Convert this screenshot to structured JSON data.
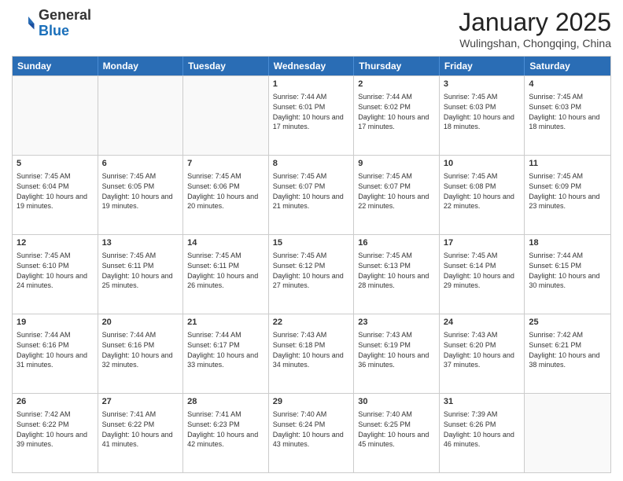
{
  "header": {
    "logo_general": "General",
    "logo_blue": "Blue",
    "month_title": "January 2025",
    "location": "Wulingshan, Chongqing, China"
  },
  "days_of_week": [
    "Sunday",
    "Monday",
    "Tuesday",
    "Wednesday",
    "Thursday",
    "Friday",
    "Saturday"
  ],
  "weeks": [
    [
      {
        "day": "",
        "sunrise": "",
        "sunset": "",
        "daylight": ""
      },
      {
        "day": "",
        "sunrise": "",
        "sunset": "",
        "daylight": ""
      },
      {
        "day": "",
        "sunrise": "",
        "sunset": "",
        "daylight": ""
      },
      {
        "day": "1",
        "sunrise": "Sunrise: 7:44 AM",
        "sunset": "Sunset: 6:01 PM",
        "daylight": "Daylight: 10 hours and 17 minutes."
      },
      {
        "day": "2",
        "sunrise": "Sunrise: 7:44 AM",
        "sunset": "Sunset: 6:02 PM",
        "daylight": "Daylight: 10 hours and 17 minutes."
      },
      {
        "day": "3",
        "sunrise": "Sunrise: 7:45 AM",
        "sunset": "Sunset: 6:03 PM",
        "daylight": "Daylight: 10 hours and 18 minutes."
      },
      {
        "day": "4",
        "sunrise": "Sunrise: 7:45 AM",
        "sunset": "Sunset: 6:03 PM",
        "daylight": "Daylight: 10 hours and 18 minutes."
      }
    ],
    [
      {
        "day": "5",
        "sunrise": "Sunrise: 7:45 AM",
        "sunset": "Sunset: 6:04 PM",
        "daylight": "Daylight: 10 hours and 19 minutes."
      },
      {
        "day": "6",
        "sunrise": "Sunrise: 7:45 AM",
        "sunset": "Sunset: 6:05 PM",
        "daylight": "Daylight: 10 hours and 19 minutes."
      },
      {
        "day": "7",
        "sunrise": "Sunrise: 7:45 AM",
        "sunset": "Sunset: 6:06 PM",
        "daylight": "Daylight: 10 hours and 20 minutes."
      },
      {
        "day": "8",
        "sunrise": "Sunrise: 7:45 AM",
        "sunset": "Sunset: 6:07 PM",
        "daylight": "Daylight: 10 hours and 21 minutes."
      },
      {
        "day": "9",
        "sunrise": "Sunrise: 7:45 AM",
        "sunset": "Sunset: 6:07 PM",
        "daylight": "Daylight: 10 hours and 22 minutes."
      },
      {
        "day": "10",
        "sunrise": "Sunrise: 7:45 AM",
        "sunset": "Sunset: 6:08 PM",
        "daylight": "Daylight: 10 hours and 22 minutes."
      },
      {
        "day": "11",
        "sunrise": "Sunrise: 7:45 AM",
        "sunset": "Sunset: 6:09 PM",
        "daylight": "Daylight: 10 hours and 23 minutes."
      }
    ],
    [
      {
        "day": "12",
        "sunrise": "Sunrise: 7:45 AM",
        "sunset": "Sunset: 6:10 PM",
        "daylight": "Daylight: 10 hours and 24 minutes."
      },
      {
        "day": "13",
        "sunrise": "Sunrise: 7:45 AM",
        "sunset": "Sunset: 6:11 PM",
        "daylight": "Daylight: 10 hours and 25 minutes."
      },
      {
        "day": "14",
        "sunrise": "Sunrise: 7:45 AM",
        "sunset": "Sunset: 6:11 PM",
        "daylight": "Daylight: 10 hours and 26 minutes."
      },
      {
        "day": "15",
        "sunrise": "Sunrise: 7:45 AM",
        "sunset": "Sunset: 6:12 PM",
        "daylight": "Daylight: 10 hours and 27 minutes."
      },
      {
        "day": "16",
        "sunrise": "Sunrise: 7:45 AM",
        "sunset": "Sunset: 6:13 PM",
        "daylight": "Daylight: 10 hours and 28 minutes."
      },
      {
        "day": "17",
        "sunrise": "Sunrise: 7:45 AM",
        "sunset": "Sunset: 6:14 PM",
        "daylight": "Daylight: 10 hours and 29 minutes."
      },
      {
        "day": "18",
        "sunrise": "Sunrise: 7:44 AM",
        "sunset": "Sunset: 6:15 PM",
        "daylight": "Daylight: 10 hours and 30 minutes."
      }
    ],
    [
      {
        "day": "19",
        "sunrise": "Sunrise: 7:44 AM",
        "sunset": "Sunset: 6:16 PM",
        "daylight": "Daylight: 10 hours and 31 minutes."
      },
      {
        "day": "20",
        "sunrise": "Sunrise: 7:44 AM",
        "sunset": "Sunset: 6:16 PM",
        "daylight": "Daylight: 10 hours and 32 minutes."
      },
      {
        "day": "21",
        "sunrise": "Sunrise: 7:44 AM",
        "sunset": "Sunset: 6:17 PM",
        "daylight": "Daylight: 10 hours and 33 minutes."
      },
      {
        "day": "22",
        "sunrise": "Sunrise: 7:43 AM",
        "sunset": "Sunset: 6:18 PM",
        "daylight": "Daylight: 10 hours and 34 minutes."
      },
      {
        "day": "23",
        "sunrise": "Sunrise: 7:43 AM",
        "sunset": "Sunset: 6:19 PM",
        "daylight": "Daylight: 10 hours and 36 minutes."
      },
      {
        "day": "24",
        "sunrise": "Sunrise: 7:43 AM",
        "sunset": "Sunset: 6:20 PM",
        "daylight": "Daylight: 10 hours and 37 minutes."
      },
      {
        "day": "25",
        "sunrise": "Sunrise: 7:42 AM",
        "sunset": "Sunset: 6:21 PM",
        "daylight": "Daylight: 10 hours and 38 minutes."
      }
    ],
    [
      {
        "day": "26",
        "sunrise": "Sunrise: 7:42 AM",
        "sunset": "Sunset: 6:22 PM",
        "daylight": "Daylight: 10 hours and 39 minutes."
      },
      {
        "day": "27",
        "sunrise": "Sunrise: 7:41 AM",
        "sunset": "Sunset: 6:22 PM",
        "daylight": "Daylight: 10 hours and 41 minutes."
      },
      {
        "day": "28",
        "sunrise": "Sunrise: 7:41 AM",
        "sunset": "Sunset: 6:23 PM",
        "daylight": "Daylight: 10 hours and 42 minutes."
      },
      {
        "day": "29",
        "sunrise": "Sunrise: 7:40 AM",
        "sunset": "Sunset: 6:24 PM",
        "daylight": "Daylight: 10 hours and 43 minutes."
      },
      {
        "day": "30",
        "sunrise": "Sunrise: 7:40 AM",
        "sunset": "Sunset: 6:25 PM",
        "daylight": "Daylight: 10 hours and 45 minutes."
      },
      {
        "day": "31",
        "sunrise": "Sunrise: 7:39 AM",
        "sunset": "Sunset: 6:26 PM",
        "daylight": "Daylight: 10 hours and 46 minutes."
      },
      {
        "day": "",
        "sunrise": "",
        "sunset": "",
        "daylight": ""
      }
    ]
  ]
}
